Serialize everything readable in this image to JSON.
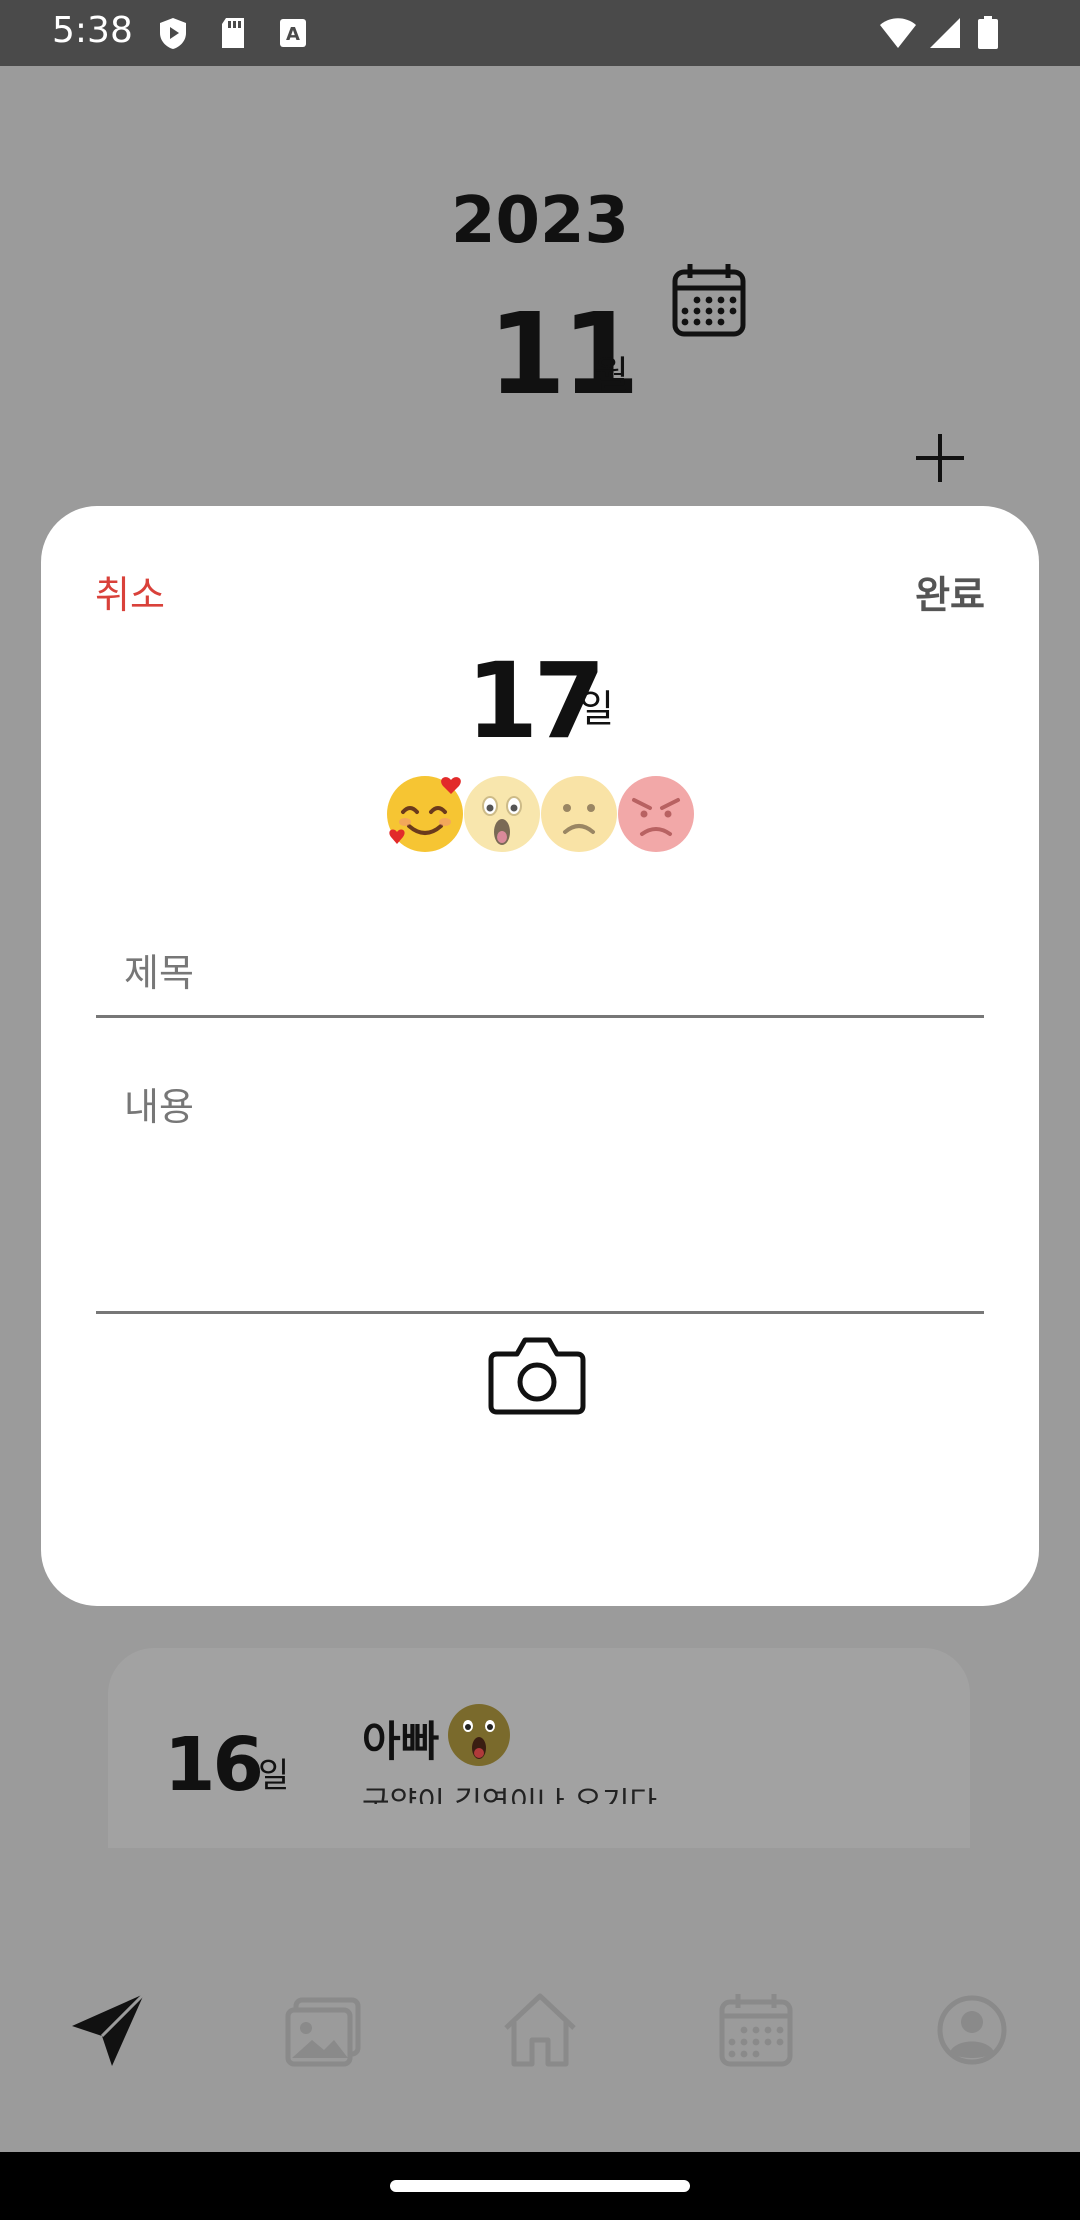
{
  "status_bar": {
    "time": "5:38",
    "icons": [
      "play-protect-icon",
      "sd-card-icon",
      "keyboard-a-icon",
      "wifi-icon",
      "signal-icon",
      "battery-icon"
    ]
  },
  "header": {
    "year": "2023",
    "month": "11",
    "month_unit": "월"
  },
  "entries": [
    {
      "day": "16",
      "day_unit": "일",
      "title": "아빠",
      "emoji": "surprised-emoji",
      "preview": "구약이 김연이나 오기다"
    }
  ],
  "modal": {
    "cancel_label": "취소",
    "done_label": "완료",
    "day": "17",
    "day_unit": "일",
    "moods": [
      "love-emoji",
      "surprised-emoji",
      "sad-emoji",
      "angry-emoji"
    ],
    "title_placeholder": "제목",
    "content_placeholder": "내용"
  },
  "nav": {
    "items": [
      "send-icon",
      "gallery-icon",
      "home-icon",
      "calendar-icon",
      "profile-icon"
    ],
    "active": "send-icon"
  },
  "colors": {
    "cancel": "#d9413a",
    "scrim": "#9b9b9b",
    "card": "#ffffff"
  }
}
